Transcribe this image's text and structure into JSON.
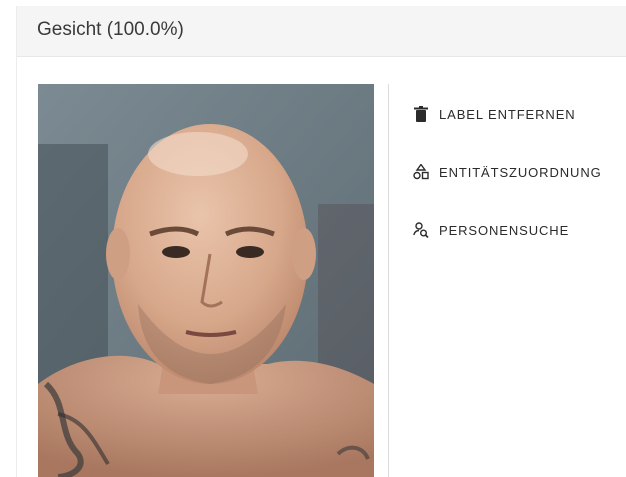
{
  "panel": {
    "title": "Gesicht (100.0%)"
  },
  "image": {
    "alt": "face crop"
  },
  "actions": [
    {
      "label": "LABEL ENTFERNEN",
      "icon": "trash-icon"
    },
    {
      "label": "ENTITÄTSZUORDNUNG",
      "icon": "entity-mapping-icon"
    },
    {
      "label": "PERSONENSUCHE",
      "icon": "person-search-icon"
    }
  ],
  "colors": {
    "header_bg": "#f5f5f5",
    "text": "#2b2b2b",
    "divider": "#dcdcdc"
  }
}
